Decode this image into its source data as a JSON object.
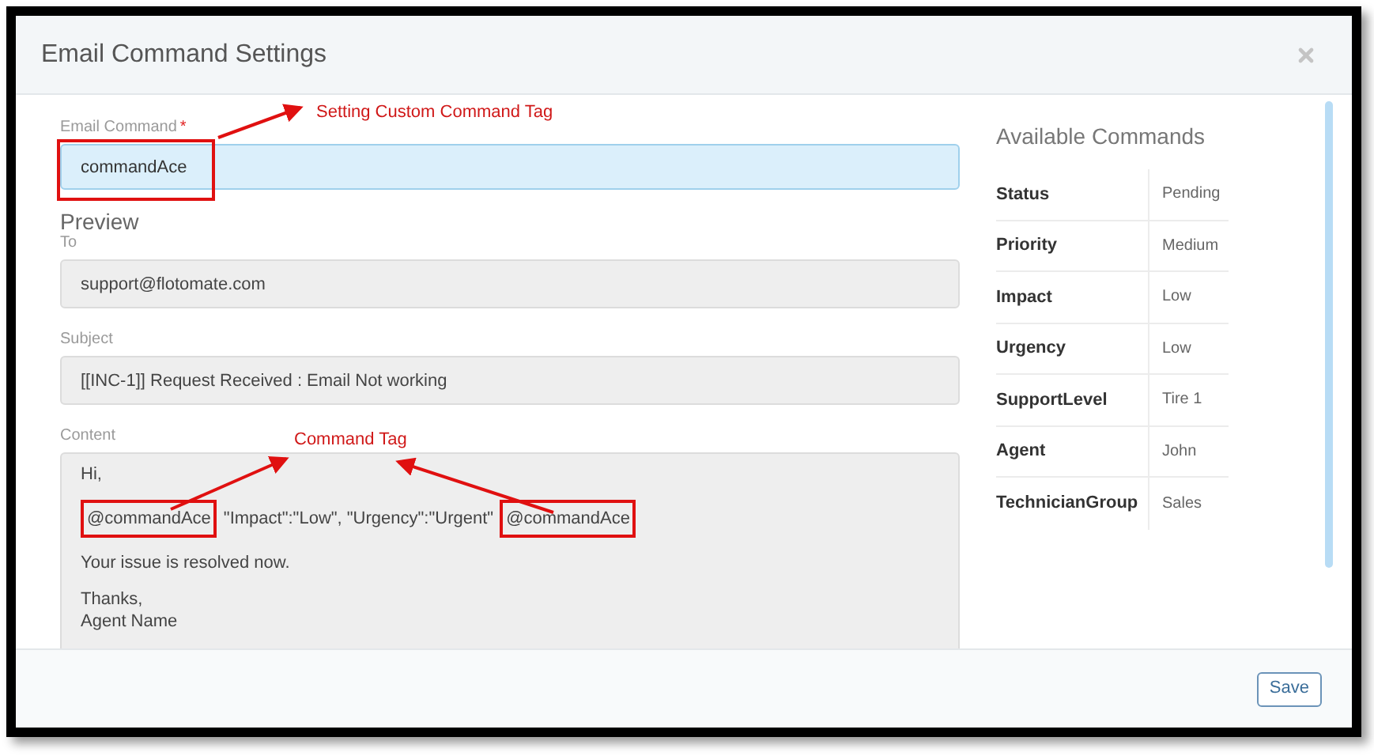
{
  "dialog": {
    "title": "Email Command Settings"
  },
  "form": {
    "email_command": {
      "label": "Email Command",
      "required_mark": "*",
      "value": "commandAce"
    },
    "preview_heading": "Preview",
    "to": {
      "label": "To",
      "value": "support@flotomate.com"
    },
    "subject": {
      "label": "Subject",
      "value": "[[INC-1]] Request Received : Email Not working"
    },
    "content": {
      "label": "Content",
      "paragraphs": [
        {
          "lines": [
            [
              {
                "kind": "plain",
                "text": "Hi,"
              }
            ]
          ]
        },
        {
          "lines": [
            [
              {
                "kind": "tag",
                "text": "@commandAce"
              },
              {
                "kind": "plain",
                "text": "\"Impact\":\"Low\", \"Urgency\":\"Urgent\""
              },
              {
                "kind": "tag",
                "text": "@commandAce"
              }
            ]
          ]
        },
        {
          "lines": [
            [
              {
                "kind": "plain",
                "text": "Your issue is resolved now."
              }
            ]
          ]
        },
        {
          "lines": [
            [
              {
                "kind": "plain",
                "text": "Thanks,"
              }
            ],
            [
              {
                "kind": "plain",
                "text": "Agent Name"
              }
            ]
          ]
        }
      ]
    }
  },
  "available_commands": {
    "title": "Available Commands",
    "rows": [
      {
        "name": "Status",
        "value": "Pending"
      },
      {
        "name": "Priority",
        "value": "Medium"
      },
      {
        "name": "Impact",
        "value": "Low"
      },
      {
        "name": "Urgency",
        "value": "Low"
      },
      {
        "name": "SupportLevel",
        "value": "Tire 1"
      },
      {
        "name": "Agent",
        "value": "John"
      },
      {
        "name": "TechnicianGroup",
        "value": "Sales"
      }
    ]
  },
  "footer": {
    "buttons": [
      "Save"
    ]
  },
  "annotations": [
    {
      "text": "Setting Custom Command Tag"
    },
    {
      "text": "Command Tag"
    }
  ]
}
